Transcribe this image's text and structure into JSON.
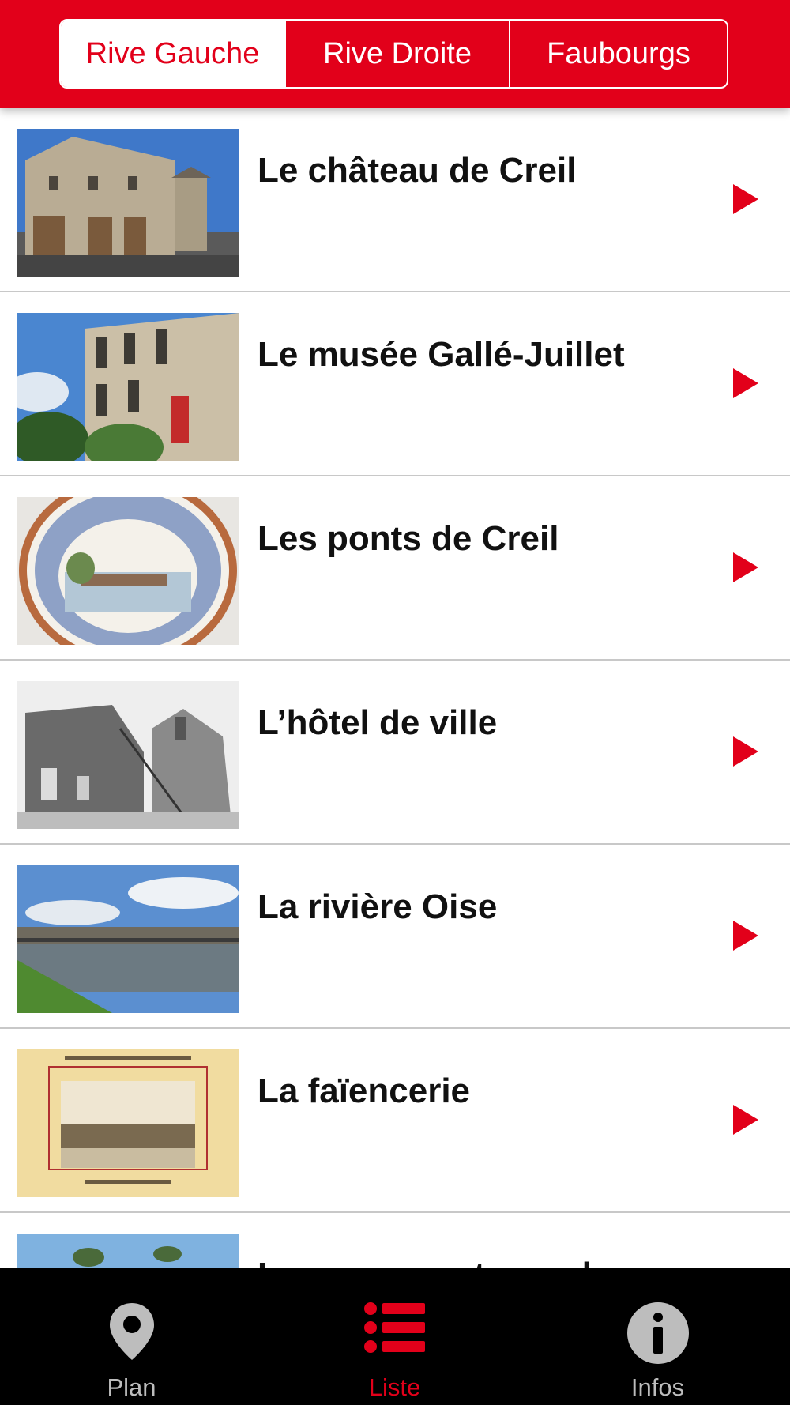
{
  "segments": [
    "Rive Gauche",
    "Rive Droite",
    "Faubourgs"
  ],
  "active_segment": "Rive Gauche",
  "items": [
    {
      "title": "Le château de Creil"
    },
    {
      "title": "Le musée Gallé-Juillet"
    },
    {
      "title": "Les ponts de Creil"
    },
    {
      "title": "L’hôtel de ville"
    },
    {
      "title": "La rivière Oise"
    },
    {
      "title": "La faïencerie"
    },
    {
      "title": "Le monument pour la"
    }
  ],
  "tabs": [
    {
      "label": "Plan",
      "icon": "map-pin-icon"
    },
    {
      "label": "Liste",
      "icon": "list-icon"
    },
    {
      "label": "Infos",
      "icon": "info-icon"
    }
  ],
  "active_tab": "Liste",
  "colors": {
    "accent": "#e2001a",
    "tabbar": "#000000",
    "inactive_tab": "#bdbdbd"
  }
}
